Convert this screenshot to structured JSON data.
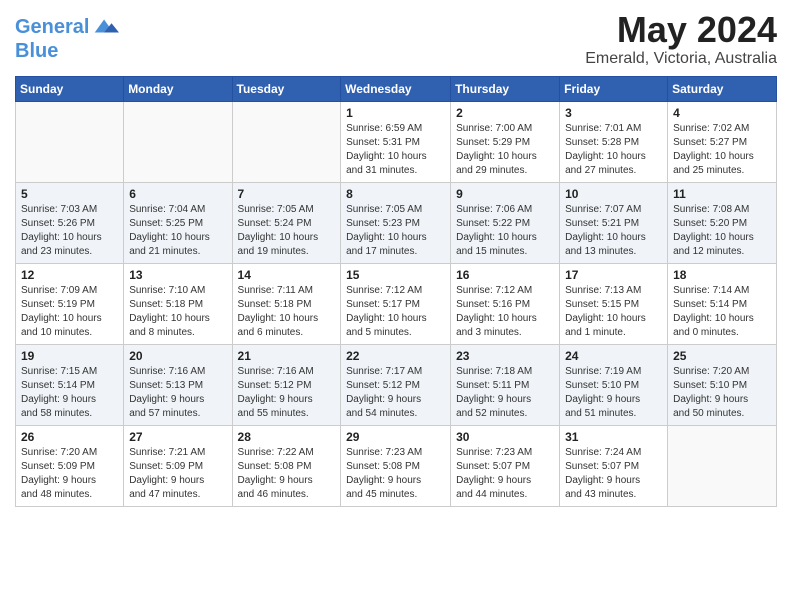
{
  "logo": {
    "line1": "General",
    "line2": "Blue"
  },
  "title": "May 2024",
  "subtitle": "Emerald, Victoria, Australia",
  "weekdays": [
    "Sunday",
    "Monday",
    "Tuesday",
    "Wednesday",
    "Thursday",
    "Friday",
    "Saturday"
  ],
  "weeks": [
    [
      {
        "day": "",
        "info": ""
      },
      {
        "day": "",
        "info": ""
      },
      {
        "day": "",
        "info": ""
      },
      {
        "day": "1",
        "info": "Sunrise: 6:59 AM\nSunset: 5:31 PM\nDaylight: 10 hours\nand 31 minutes."
      },
      {
        "day": "2",
        "info": "Sunrise: 7:00 AM\nSunset: 5:29 PM\nDaylight: 10 hours\nand 29 minutes."
      },
      {
        "day": "3",
        "info": "Sunrise: 7:01 AM\nSunset: 5:28 PM\nDaylight: 10 hours\nand 27 minutes."
      },
      {
        "day": "4",
        "info": "Sunrise: 7:02 AM\nSunset: 5:27 PM\nDaylight: 10 hours\nand 25 minutes."
      }
    ],
    [
      {
        "day": "5",
        "info": "Sunrise: 7:03 AM\nSunset: 5:26 PM\nDaylight: 10 hours\nand 23 minutes."
      },
      {
        "day": "6",
        "info": "Sunrise: 7:04 AM\nSunset: 5:25 PM\nDaylight: 10 hours\nand 21 minutes."
      },
      {
        "day": "7",
        "info": "Sunrise: 7:05 AM\nSunset: 5:24 PM\nDaylight: 10 hours\nand 19 minutes."
      },
      {
        "day": "8",
        "info": "Sunrise: 7:05 AM\nSunset: 5:23 PM\nDaylight: 10 hours\nand 17 minutes."
      },
      {
        "day": "9",
        "info": "Sunrise: 7:06 AM\nSunset: 5:22 PM\nDaylight: 10 hours\nand 15 minutes."
      },
      {
        "day": "10",
        "info": "Sunrise: 7:07 AM\nSunset: 5:21 PM\nDaylight: 10 hours\nand 13 minutes."
      },
      {
        "day": "11",
        "info": "Sunrise: 7:08 AM\nSunset: 5:20 PM\nDaylight: 10 hours\nand 12 minutes."
      }
    ],
    [
      {
        "day": "12",
        "info": "Sunrise: 7:09 AM\nSunset: 5:19 PM\nDaylight: 10 hours\nand 10 minutes."
      },
      {
        "day": "13",
        "info": "Sunrise: 7:10 AM\nSunset: 5:18 PM\nDaylight: 10 hours\nand 8 minutes."
      },
      {
        "day": "14",
        "info": "Sunrise: 7:11 AM\nSunset: 5:18 PM\nDaylight: 10 hours\nand 6 minutes."
      },
      {
        "day": "15",
        "info": "Sunrise: 7:12 AM\nSunset: 5:17 PM\nDaylight: 10 hours\nand 5 minutes."
      },
      {
        "day": "16",
        "info": "Sunrise: 7:12 AM\nSunset: 5:16 PM\nDaylight: 10 hours\nand 3 minutes."
      },
      {
        "day": "17",
        "info": "Sunrise: 7:13 AM\nSunset: 5:15 PM\nDaylight: 10 hours\nand 1 minute."
      },
      {
        "day": "18",
        "info": "Sunrise: 7:14 AM\nSunset: 5:14 PM\nDaylight: 10 hours\nand 0 minutes."
      }
    ],
    [
      {
        "day": "19",
        "info": "Sunrise: 7:15 AM\nSunset: 5:14 PM\nDaylight: 9 hours\nand 58 minutes."
      },
      {
        "day": "20",
        "info": "Sunrise: 7:16 AM\nSunset: 5:13 PM\nDaylight: 9 hours\nand 57 minutes."
      },
      {
        "day": "21",
        "info": "Sunrise: 7:16 AM\nSunset: 5:12 PM\nDaylight: 9 hours\nand 55 minutes."
      },
      {
        "day": "22",
        "info": "Sunrise: 7:17 AM\nSunset: 5:12 PM\nDaylight: 9 hours\nand 54 minutes."
      },
      {
        "day": "23",
        "info": "Sunrise: 7:18 AM\nSunset: 5:11 PM\nDaylight: 9 hours\nand 52 minutes."
      },
      {
        "day": "24",
        "info": "Sunrise: 7:19 AM\nSunset: 5:10 PM\nDaylight: 9 hours\nand 51 minutes."
      },
      {
        "day": "25",
        "info": "Sunrise: 7:20 AM\nSunset: 5:10 PM\nDaylight: 9 hours\nand 50 minutes."
      }
    ],
    [
      {
        "day": "26",
        "info": "Sunrise: 7:20 AM\nSunset: 5:09 PM\nDaylight: 9 hours\nand 48 minutes."
      },
      {
        "day": "27",
        "info": "Sunrise: 7:21 AM\nSunset: 5:09 PM\nDaylight: 9 hours\nand 47 minutes."
      },
      {
        "day": "28",
        "info": "Sunrise: 7:22 AM\nSunset: 5:08 PM\nDaylight: 9 hours\nand 46 minutes."
      },
      {
        "day": "29",
        "info": "Sunrise: 7:23 AM\nSunset: 5:08 PM\nDaylight: 9 hours\nand 45 minutes."
      },
      {
        "day": "30",
        "info": "Sunrise: 7:23 AM\nSunset: 5:07 PM\nDaylight: 9 hours\nand 44 minutes."
      },
      {
        "day": "31",
        "info": "Sunrise: 7:24 AM\nSunset: 5:07 PM\nDaylight: 9 hours\nand 43 minutes."
      },
      {
        "day": "",
        "info": ""
      }
    ]
  ]
}
